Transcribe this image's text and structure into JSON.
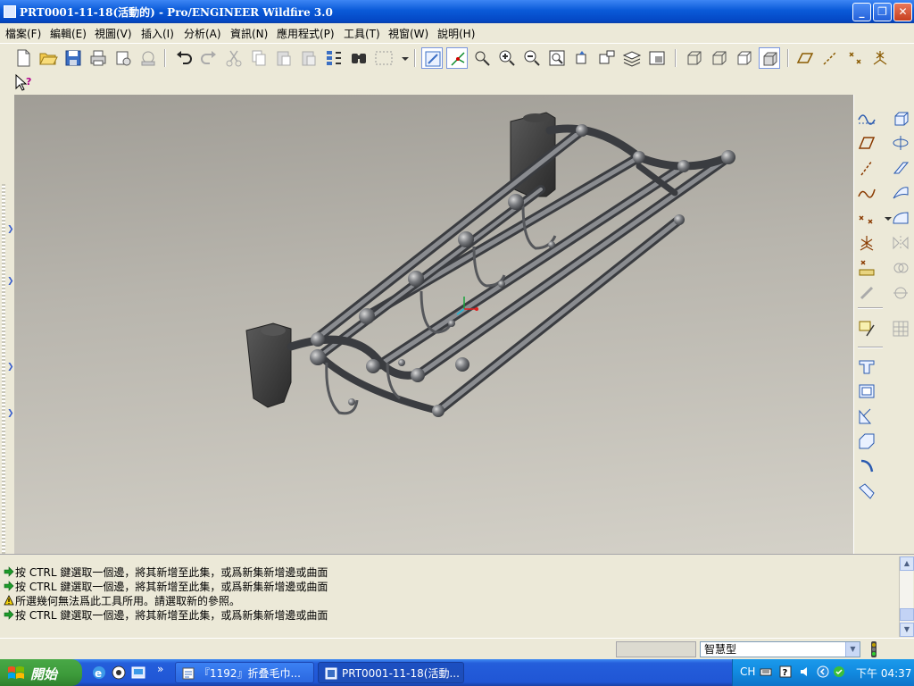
{
  "window": {
    "title": "PRT0001-11-18(活動的) - Pro/ENGINEER Wildfire 3.0",
    "minimize_label": "_",
    "maximize_label": "❐",
    "close_label": "✕"
  },
  "menu": {
    "items": [
      "檔案(F)",
      "編輯(E)",
      "視圖(V)",
      "插入(I)",
      "分析(A)",
      "資訊(N)",
      "應用程式(P)",
      "工具(T)",
      "視窗(W)",
      "說明(H)"
    ]
  },
  "messages": [
    {
      "type": "prompt",
      "text": "按 CTRL 鍵選取一個邊，將其新增至此集，或爲新集新增邊或曲面"
    },
    {
      "type": "prompt",
      "text": "按 CTRL 鍵選取一個邊，將其新增至此集，或爲新集新增邊或曲面"
    },
    {
      "type": "warning",
      "text": "所選幾何無法爲此工具所用。請選取新的參照。"
    },
    {
      "type": "prompt",
      "text": "按 CTRL 鍵選取一個邊，將其新增至此集，或爲新集新增邊或曲面"
    }
  ],
  "status": {
    "filter_value": "智慧型"
  },
  "taskbar": {
    "start_label": "開始",
    "expand_label": "»",
    "tasks": [
      {
        "label": "『1192』折叠毛巾...",
        "active": false
      },
      {
        "label": "PRT0001-11-18(活動...",
        "active": true
      }
    ],
    "language": "CH",
    "clock": "下午 04:37"
  },
  "colors": {
    "title_bar": "#0a5ad8",
    "chrome": "#ece9d8",
    "viewport_top": "#a09d96",
    "viewport_bottom": "#d4d1c8",
    "model_metal": "#6e7074"
  }
}
